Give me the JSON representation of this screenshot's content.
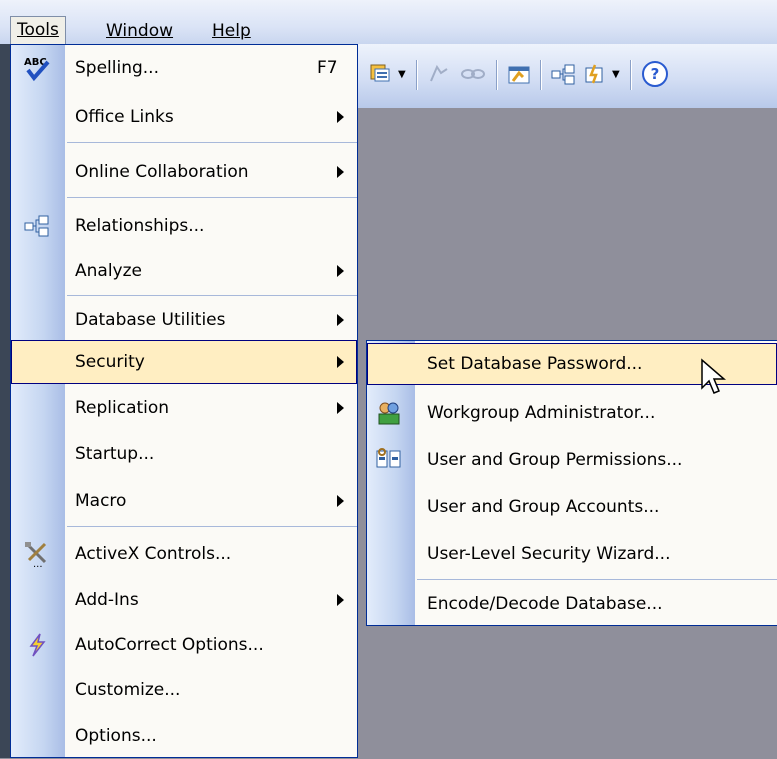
{
  "menubar": {
    "items": [
      {
        "label": "Tools"
      },
      {
        "label": "Window"
      },
      {
        "label": "Help"
      }
    ]
  },
  "tools_menu": {
    "items": [
      {
        "label": "Spelling...",
        "shortcut": "F7",
        "icon": "spelling-abc-check-icon"
      },
      {
        "label": "Office Links",
        "submenu": true
      },
      {
        "label": "Online Collaboration",
        "submenu": true
      },
      {
        "label": "Relationships...",
        "icon": "relationships-icon"
      },
      {
        "label": "Analyze",
        "submenu": true
      },
      {
        "label": "Database Utilities",
        "submenu": true
      },
      {
        "label": "Security",
        "submenu": true,
        "highlighted": true
      },
      {
        "label": "Replication",
        "submenu": true
      },
      {
        "label": "Startup..."
      },
      {
        "label": "Macro",
        "submenu": true
      },
      {
        "label": "ActiveX Controls...",
        "icon": "activex-tools-icon"
      },
      {
        "label": "Add-Ins",
        "submenu": true
      },
      {
        "label": "AutoCorrect Options...",
        "icon": "autocorrect-lightning-icon"
      },
      {
        "label": "Customize..."
      },
      {
        "label": "Options..."
      }
    ]
  },
  "security_submenu": {
    "items": [
      {
        "label": "Set Database Password...",
        "highlighted": true
      },
      {
        "label": "Workgroup Administrator...",
        "icon": "workgroup-admin-icon"
      },
      {
        "label": "User and Group Permissions...",
        "icon": "permissions-icon"
      },
      {
        "label": "User and Group Accounts..."
      },
      {
        "label": "User-Level Security Wizard..."
      },
      {
        "label": "Encode/Decode Database..."
      }
    ]
  },
  "colors": {
    "highlight": "#ffeec2",
    "menu_border": "#002d96",
    "background": "#8f8f9b"
  }
}
